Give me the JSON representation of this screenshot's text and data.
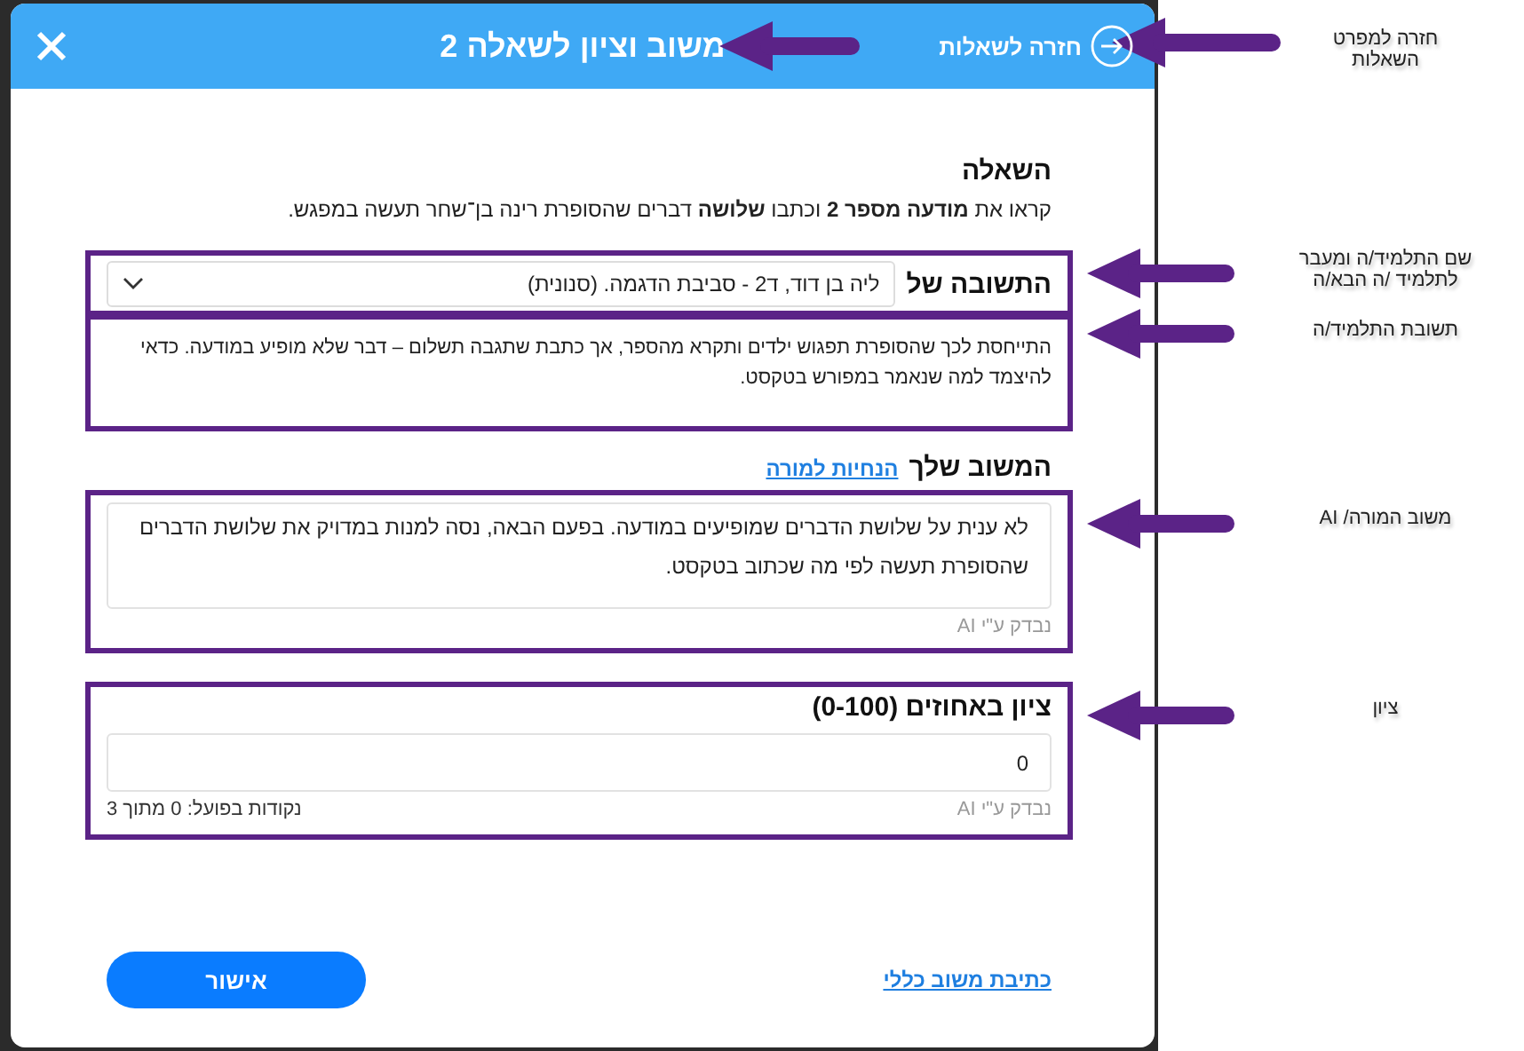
{
  "dialog": {
    "title": "משוב וציון לשאלה 2",
    "back_label": "חזרה לשאלות",
    "question": {
      "heading": "השאלה",
      "text": "קראו את **מודעה מספר 2** וכתבו **שלושה** דברים שהסופרת רינה בן־שחר תעשה במפגש."
    },
    "student": {
      "label": "התשובה של",
      "value": "ליה בן דוד, ד2 - סביבת הדגמה. (סנונית)"
    },
    "answer": "התייחסת לכך שהסופרת תפגוש ילדים ותקרא מהספר, אך כתבת שתגבה תשלום – דבר שלא מופיע במודעה. כדאי להיצמד למה שנאמר במפורש בטקסט.",
    "feedback": {
      "heading": "המשוב שלך",
      "guide_link": "הנחיות למורה",
      "value": "לא ענית על שלושת הדברים שמופיעים במודעה. בפעם הבאה, נסה למנות במדויק את שלושת הדברים שהסופרת תעשה לפי מה שכתוב בטקסט.",
      "source": "נבדק ע\"י AI"
    },
    "grade": {
      "heading": "ציון באחוזים (0-100)",
      "value": "0",
      "source": "נבדק ע\"י AI",
      "points": "נקודות בפועל: 0 מתוך 3"
    },
    "footer": {
      "link": "כתיבת משוב כללי",
      "confirm": "אישור"
    }
  },
  "annotations": [
    {
      "text": "חזרה למפרט\nהשאלות"
    },
    {
      "text": "שם התלמיד/ה ומעבר\nלתלמיד /ה הבא/ה"
    },
    {
      "text": "תשובת התלמיד/ה"
    },
    {
      "text": "משוב המורה/ AI"
    },
    {
      "text": "ציון"
    }
  ]
}
